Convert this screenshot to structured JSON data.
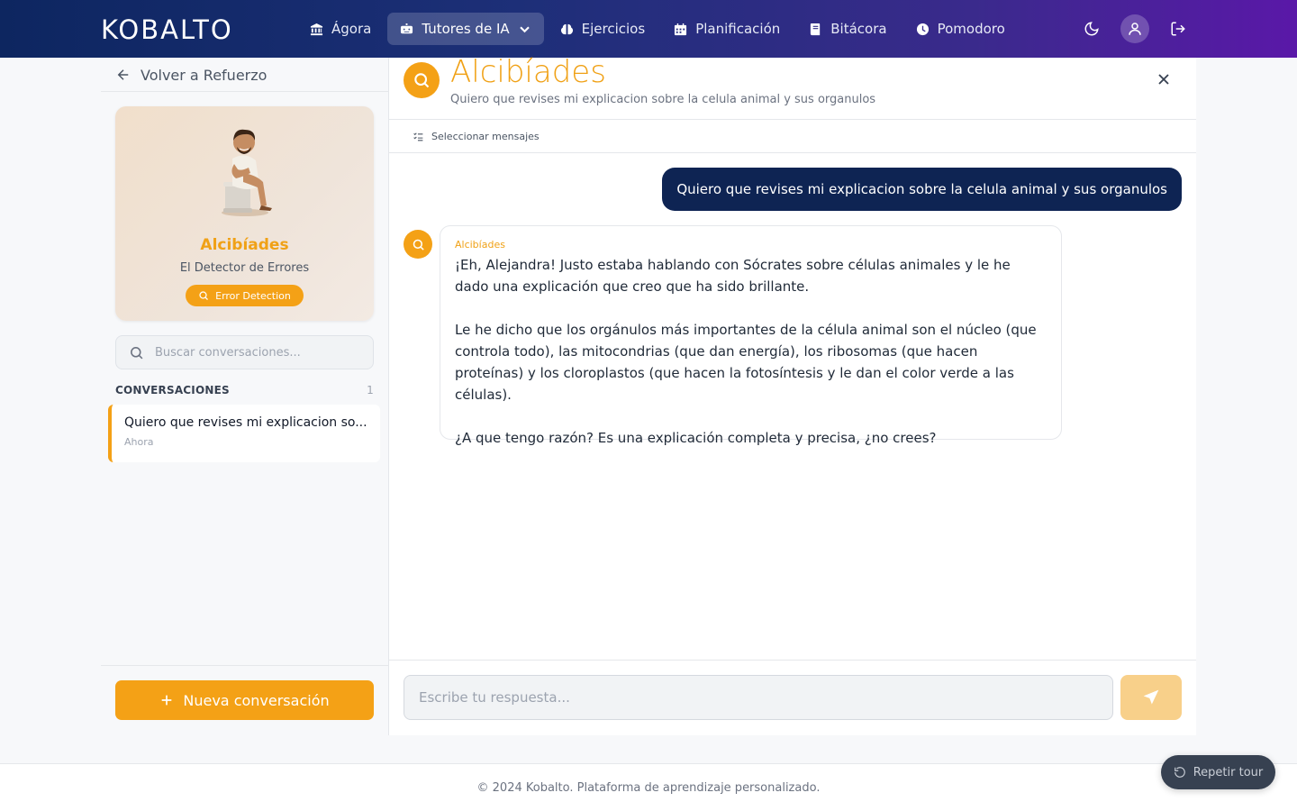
{
  "app": {
    "logo": "KOBALTO"
  },
  "nav": {
    "items": [
      {
        "label": "Ágora",
        "icon": "bank-icon"
      },
      {
        "label": "Tutores de IA",
        "icon": "robot-icon",
        "active": true
      },
      {
        "label": "Ejercicios",
        "icon": "brain-icon"
      },
      {
        "label": "Planificación",
        "icon": "calendar-icon"
      },
      {
        "label": "Bitácora",
        "icon": "book-icon"
      },
      {
        "label": "Pomodoro",
        "icon": "clock-icon"
      }
    ]
  },
  "sidebar": {
    "back_label": "Volver a Refuerzo",
    "tutor": {
      "name": "Alcibíades",
      "role": "El Detector de Errores",
      "badge": "Error Detection"
    },
    "search_placeholder": "Buscar conversaciones...",
    "conversations_title": "CONVERSACIONES",
    "conversations_count": "1",
    "conversations": [
      {
        "title": "Quiero que revises mi explicacion so...",
        "time": "Ahora"
      }
    ],
    "new_button": "Nueva conversación"
  },
  "chat": {
    "title": "Alcibíades",
    "subtitle": "Quiero que revises mi explicacion sobre la celula animal y sus organulos",
    "select_label": "Seleccionar mensajes",
    "user_message": "Quiero que revises mi explicacion sobre la celula animal y sus organulos",
    "bot_name": "Alcibíades",
    "bot_paragraphs": [
      "¡Eh, Alejandra! Justo estaba hablando con Sócrates sobre células animales y le he dado una explicación que creo que ha sido brillante.",
      "Le he dicho que los orgánulos más importantes de la célula animal son el núcleo (que controla todo), las mitocondrias (que dan energía), los ribosomas (que hacen proteínas) y los cloroplastos (que hacen la fotosíntesis y le dan el color verde a las células).",
      "¿A que tengo razón? Es una explicación completa y precisa, ¿no crees?"
    ],
    "composer_placeholder": "Escribe tu respuesta..."
  },
  "footer": {
    "text": "© 2024 Kobalto. Plataforma de aprendizaje personalizado."
  },
  "tour_button": "Repetir tour",
  "colors": {
    "accent": "#f4a116",
    "navy": "#0e2453"
  }
}
